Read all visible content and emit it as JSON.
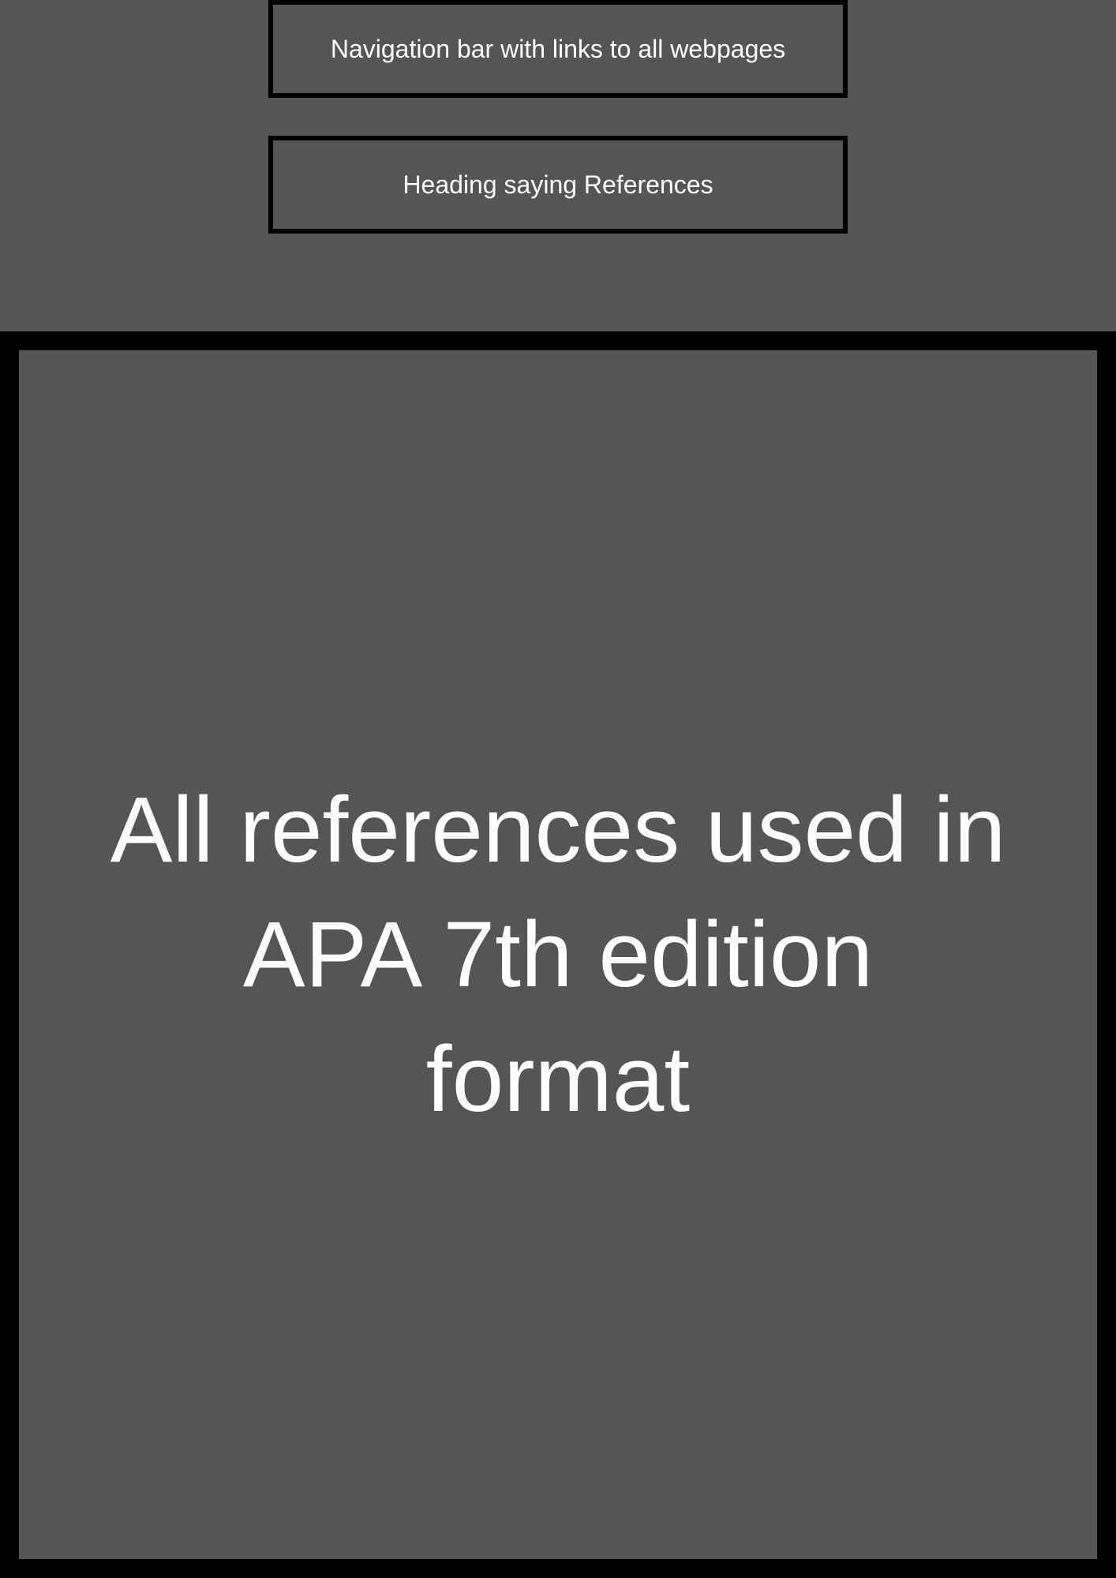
{
  "nav_box": {
    "label": "Navigation bar with links to all webpages"
  },
  "heading_box": {
    "label": "Heading saying References"
  },
  "content_box": {
    "label": "All references used in APA 7th edition format"
  },
  "colors": {
    "background": "#555555",
    "border": "#000000",
    "text": "#ffffff"
  }
}
